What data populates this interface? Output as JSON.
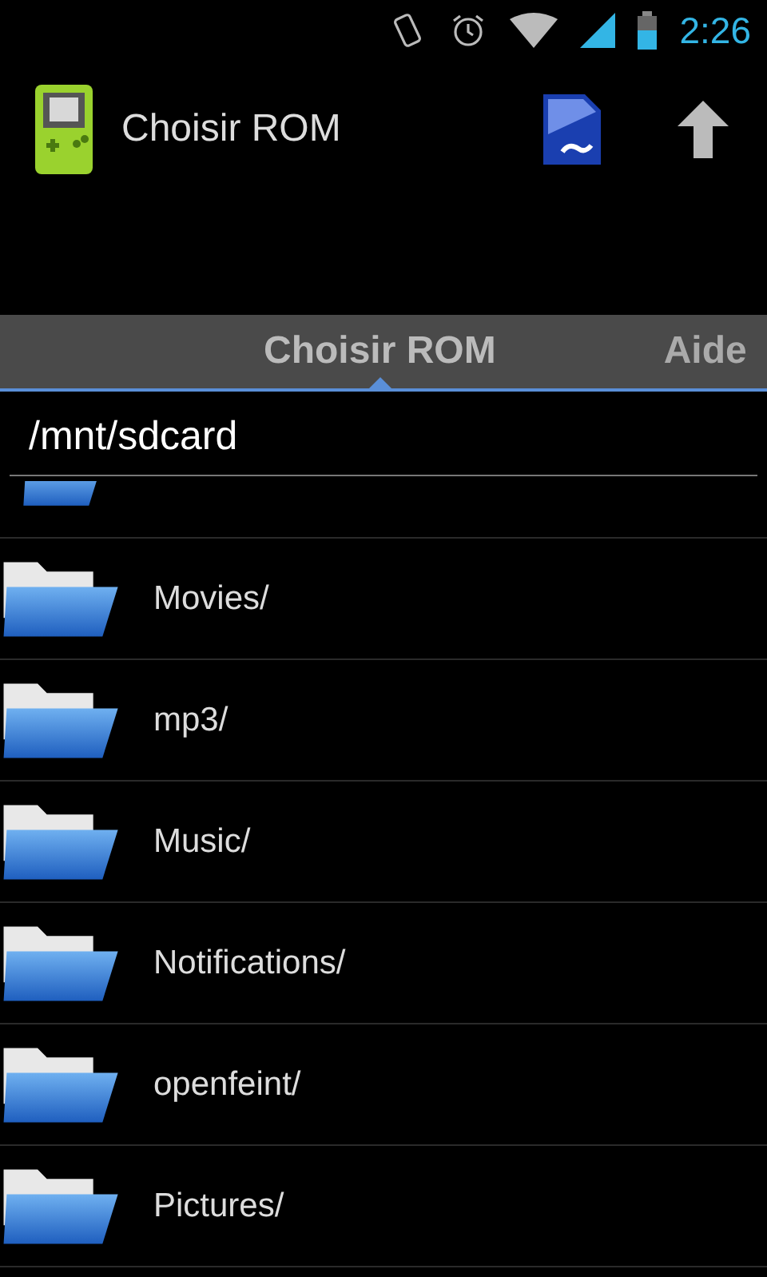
{
  "status_bar": {
    "time": "2:26"
  },
  "action_bar": {
    "title": "Choisir ROM"
  },
  "tabs": [
    {
      "label": "Choisir ROM",
      "selected": true
    },
    {
      "label": "Aide",
      "selected": false
    }
  ],
  "path_field": {
    "value": "/mnt/sdcard"
  },
  "folders": [
    {
      "name": "Movies/"
    },
    {
      "name": "mp3/"
    },
    {
      "name": "Music/"
    },
    {
      "name": "Notifications/"
    },
    {
      "name": "openfeint/"
    },
    {
      "name": "Pictures/"
    }
  ]
}
